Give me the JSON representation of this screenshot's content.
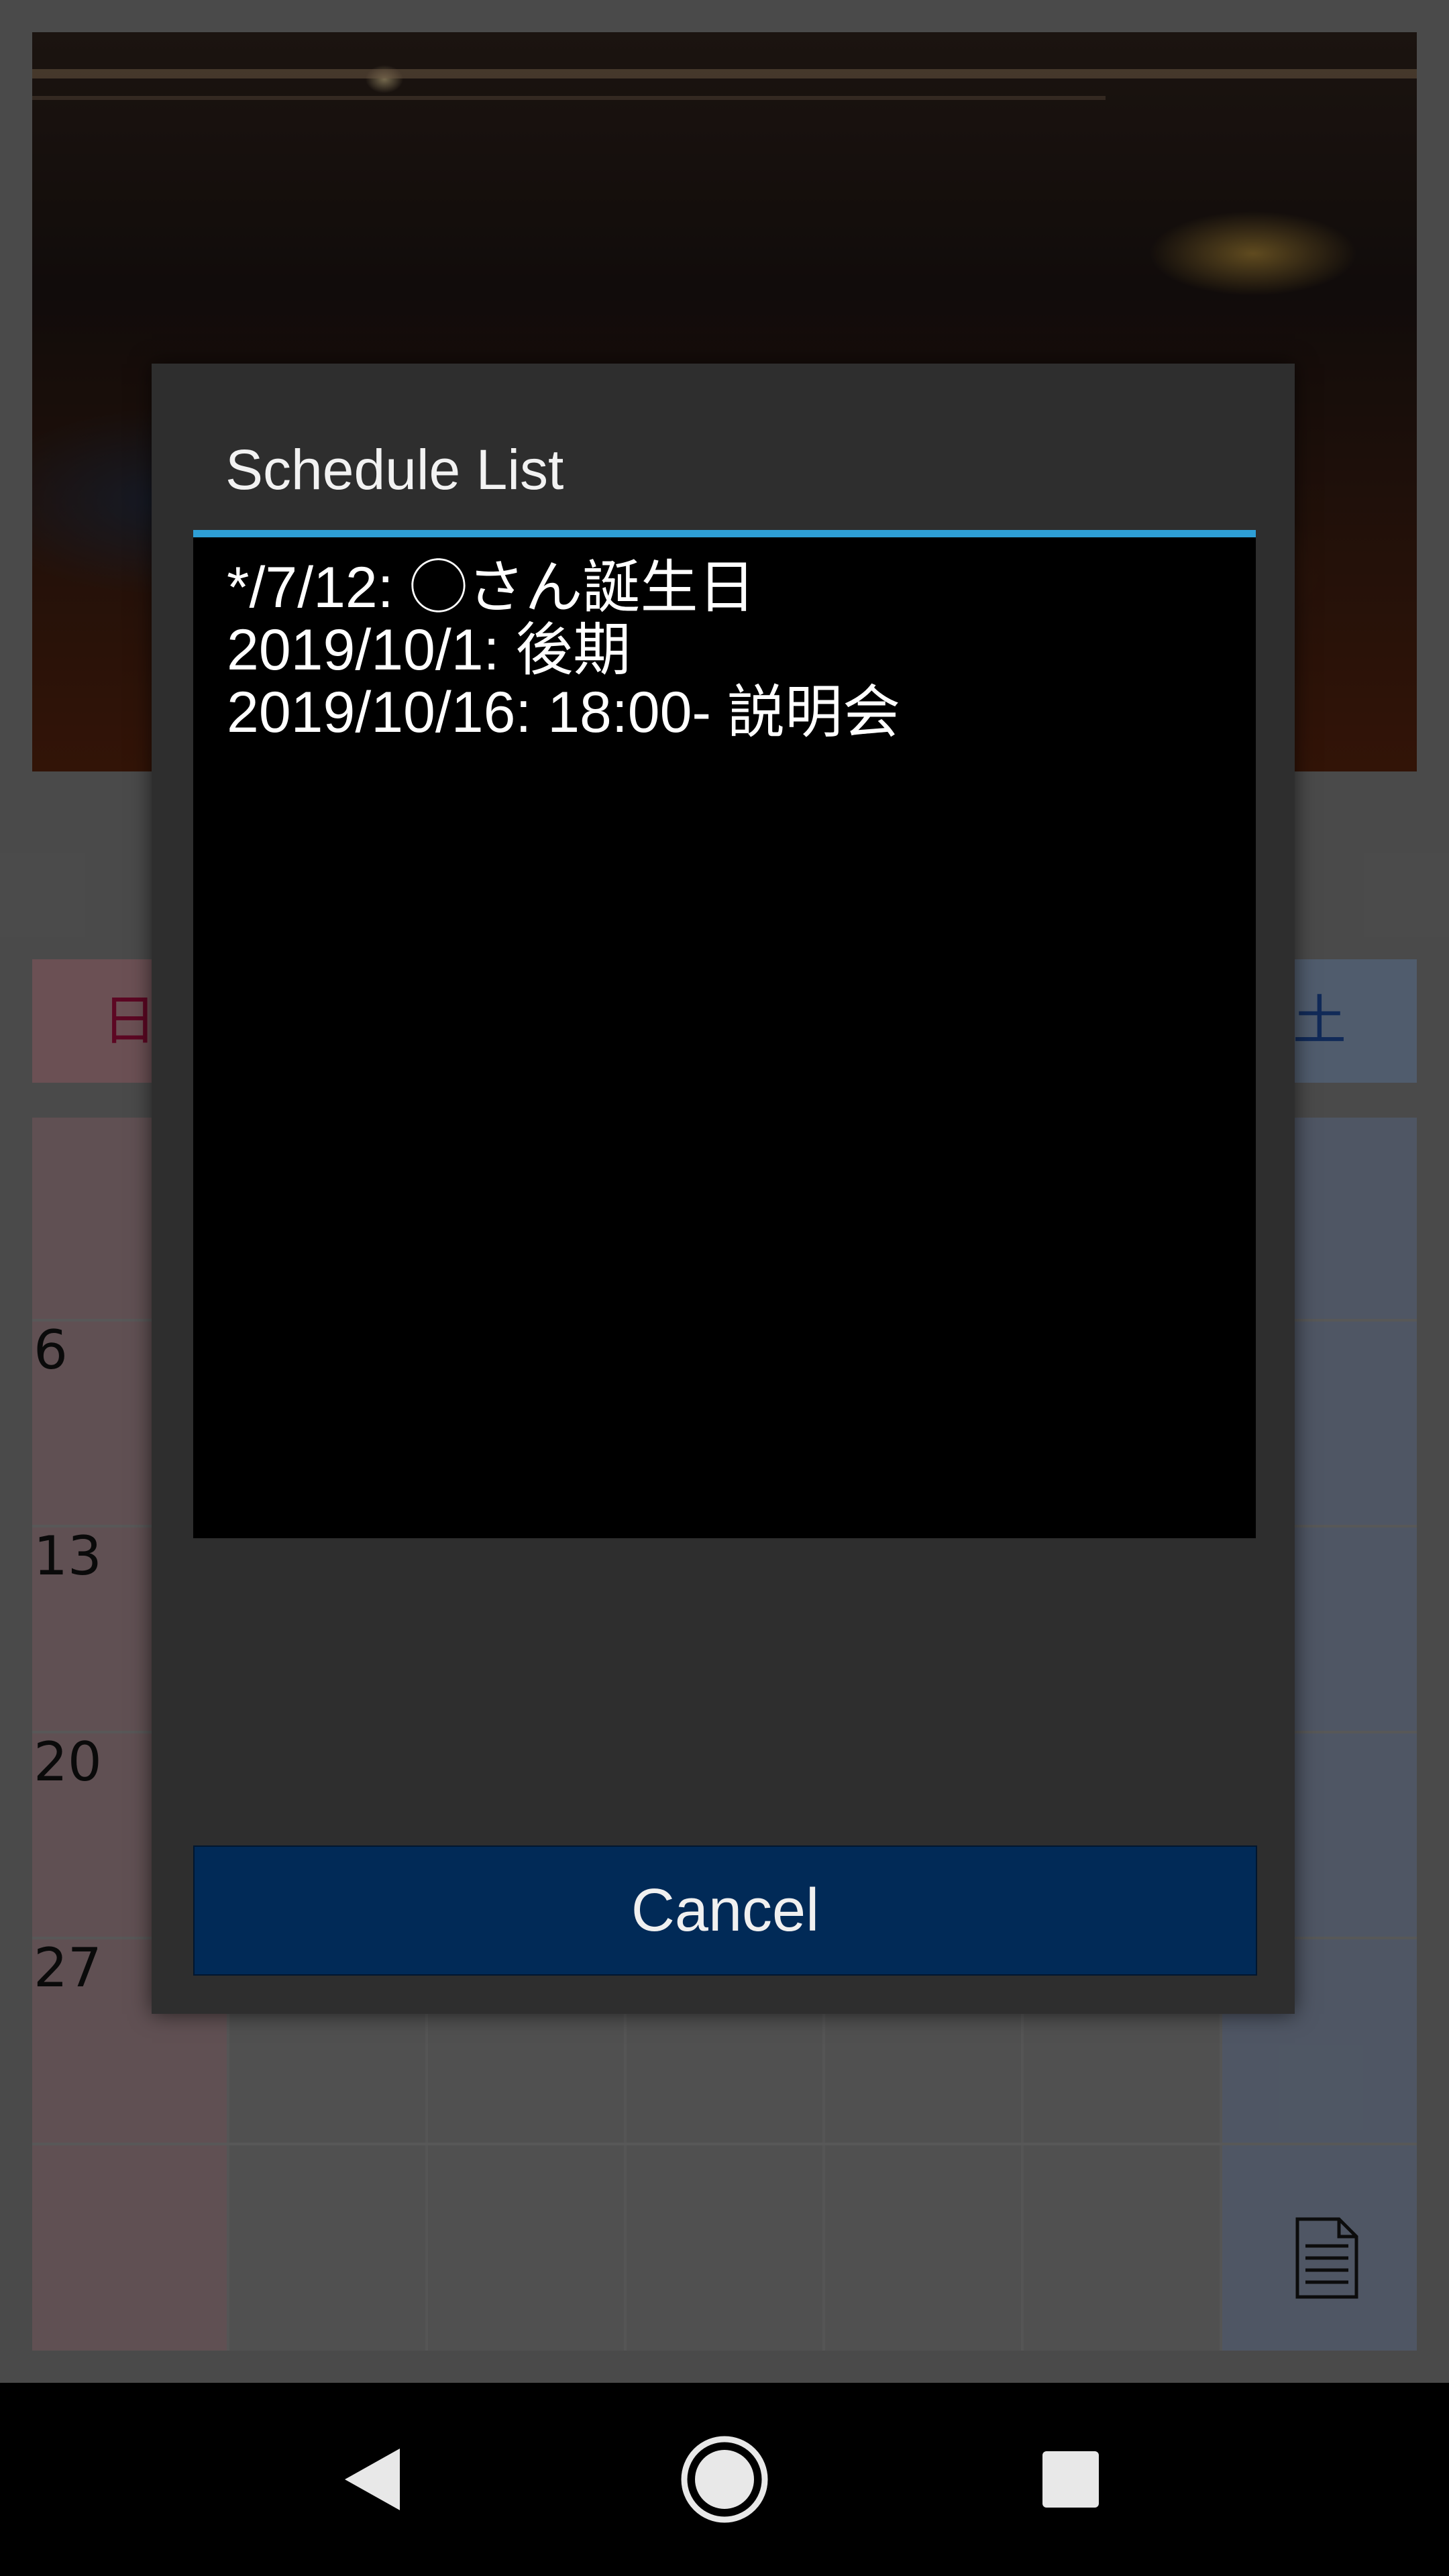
{
  "calendar": {
    "weekday_sun": "日",
    "weekday_sat": "土",
    "day_numbers": [
      "6",
      "13",
      "20",
      "27"
    ]
  },
  "dialog": {
    "title": "Schedule List",
    "items": [
      "*/7/12: ◯さん誕生日",
      "2019/10/1: 後期",
      "2019/10/16: 18:00- 説明会"
    ],
    "cancel_label": "Cancel"
  },
  "colors": {
    "accent": "#2e9fd6",
    "cancel_button": "#012a57",
    "sunday": "#c0104a",
    "saturday": "#2458b8"
  },
  "icons": {
    "memo": "memo-icon",
    "back": "back-icon",
    "home": "home-icon",
    "recent": "recent-apps-icon"
  }
}
